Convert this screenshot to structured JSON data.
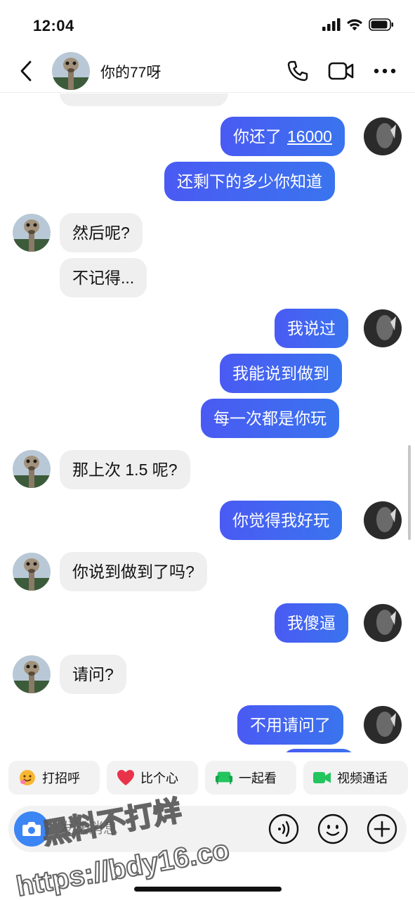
{
  "status_bar": {
    "time": "12:04"
  },
  "header": {
    "contact_name": "你的77呀"
  },
  "messages": [
    {
      "side": "out",
      "text": "你还了",
      "link": "16000"
    },
    {
      "side": "out",
      "text": "还剩下的多少你知道"
    },
    {
      "side": "in",
      "text": "然后呢?"
    },
    {
      "side": "in",
      "text": "不记得..."
    },
    {
      "side": "out",
      "text": "我说过"
    },
    {
      "side": "out",
      "text": "我能说到做到"
    },
    {
      "side": "out",
      "text": "每一次都是你玩"
    },
    {
      "side": "in",
      "text": "那上次 1.5 呢?"
    },
    {
      "side": "out",
      "text": "你觉得我好玩"
    },
    {
      "side": "in",
      "text": "你说到做到了吗?"
    },
    {
      "side": "out",
      "text": "我傻逼"
    },
    {
      "side": "in",
      "text": "请问?"
    },
    {
      "side": "out",
      "text": "不用请问了"
    }
  ],
  "quick_actions": [
    {
      "label": "打招呼",
      "icon": "wave-emoji-icon"
    },
    {
      "label": "比个心",
      "icon": "heart-icon"
    },
    {
      "label": "一起看",
      "icon": "sofa-icon"
    },
    {
      "label": "视频通话",
      "icon": "video-call-icon"
    }
  ],
  "composer": {
    "placeholder": "发送消息"
  },
  "watermark": {
    "line1": "黑料不打烊",
    "line2": "https://bdy16.co"
  },
  "colors": {
    "outgoing_bubble": "#3d6bf0",
    "incoming_bubble": "#efefef",
    "camera_button": "#3c85f5"
  }
}
